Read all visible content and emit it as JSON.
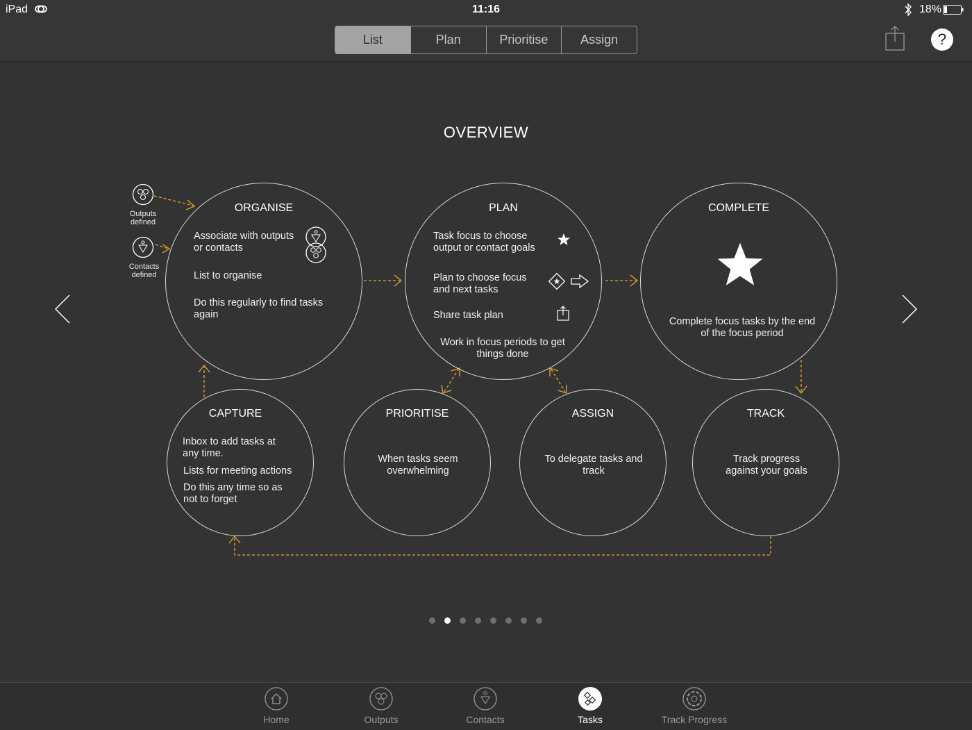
{
  "status_bar": {
    "device": "iPad",
    "time": "11:16",
    "battery": "18%"
  },
  "segments": [
    "List",
    "Plan",
    "Prioritise",
    "Assign"
  ],
  "active_segment": "List",
  "help_label": "?",
  "page_title": "OVERVIEW",
  "side_labels": {
    "outputs": [
      "Outputs",
      "defined"
    ],
    "contacts": [
      "Contacts",
      "defined"
    ]
  },
  "organise": {
    "title": "ORGANISE",
    "lines": [
      "Associate with outputs or contacts",
      "List to organise",
      "Do this regularly to find tasks again"
    ]
  },
  "plan": {
    "title": "PLAN",
    "lines": [
      "Task focus to choose output or contact goals",
      "Plan to choose focus and next tasks",
      "Share task plan",
      "Work in focus periods to get things done"
    ]
  },
  "complete": {
    "title": "COMPLETE",
    "text": "Complete focus tasks by the end of the focus period"
  },
  "capture": {
    "title": "CAPTURE",
    "lines": [
      "Inbox to add tasks at any time.",
      "Lists for meeting actions",
      "Do this any time so as not to forget"
    ]
  },
  "prioritise": {
    "title": "PRIORITISE",
    "text": "When tasks seem overwhelming"
  },
  "assign": {
    "title": "ASSIGN",
    "text": "To delegate tasks and track"
  },
  "track": {
    "title": "TRACK",
    "text": "Track progress against your goals"
  },
  "page_dots": {
    "count": 8,
    "active_index": 1
  },
  "tabs": [
    {
      "label": "Home",
      "icon": "home-icon"
    },
    {
      "label": "Outputs",
      "icon": "outputs-icon"
    },
    {
      "label": "Contacts",
      "icon": "contacts-icon"
    },
    {
      "label": "Tasks",
      "icon": "tasks-icon"
    },
    {
      "label": "Track Progress",
      "icon": "track-progress-icon"
    }
  ],
  "active_tab": "Tasks",
  "colors": {
    "background": "#333333",
    "accent_arrow": "#e0a92a",
    "line": "#d8d8d8"
  }
}
